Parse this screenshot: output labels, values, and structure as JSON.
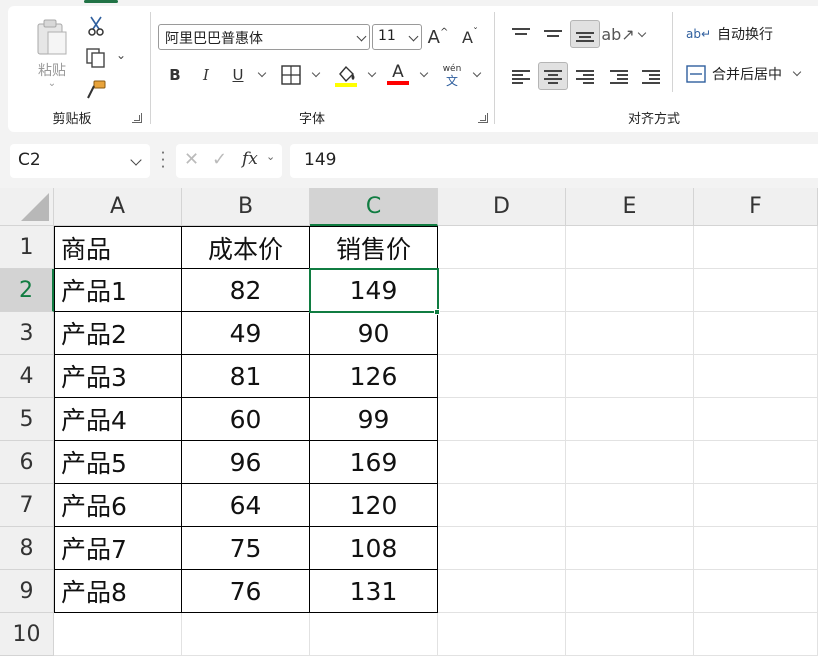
{
  "ribbon": {
    "clipboard": {
      "paste_label": "粘贴",
      "group_label": "剪贴板"
    },
    "font": {
      "font_name": "阿里巴巴普惠体",
      "font_size": "11",
      "bold": "B",
      "italic": "I",
      "underline": "U",
      "grow": "A",
      "shrink": "A",
      "font_color_letter": "A",
      "phonetic_top": "wén",
      "phonetic_bottom": "文",
      "group_label": "字体"
    },
    "alignment": {
      "wrap_text": "自动换行",
      "merge_center": "合并后居中",
      "group_label": "对齐方式"
    },
    "colors": {
      "highlight": "#ffff00",
      "font_color": "#ff0000",
      "accent": "#107c41"
    }
  },
  "formula_bar": {
    "name_box": "C2",
    "fx": "fx",
    "value": "149"
  },
  "sheet": {
    "columns": [
      "A",
      "B",
      "C",
      "D",
      "E",
      "F"
    ],
    "rows": [
      "1",
      "2",
      "3",
      "4",
      "5",
      "6",
      "7",
      "8",
      "9",
      "10"
    ],
    "header": {
      "a": "商品",
      "b": "成本价",
      "c": "销售价"
    },
    "data": [
      {
        "product": "产品1",
        "cost": "82",
        "price": "149"
      },
      {
        "product": "产品2",
        "cost": "49",
        "price": "90"
      },
      {
        "product": "产品3",
        "cost": "81",
        "price": "126"
      },
      {
        "product": "产品4",
        "cost": "60",
        "price": "99"
      },
      {
        "product": "产品5",
        "cost": "96",
        "price": "169"
      },
      {
        "product": "产品6",
        "cost": "64",
        "price": "120"
      },
      {
        "product": "产品7",
        "cost": "75",
        "price": "108"
      },
      {
        "product": "产品8",
        "cost": "76",
        "price": "131"
      }
    ],
    "active_cell": "C2"
  }
}
